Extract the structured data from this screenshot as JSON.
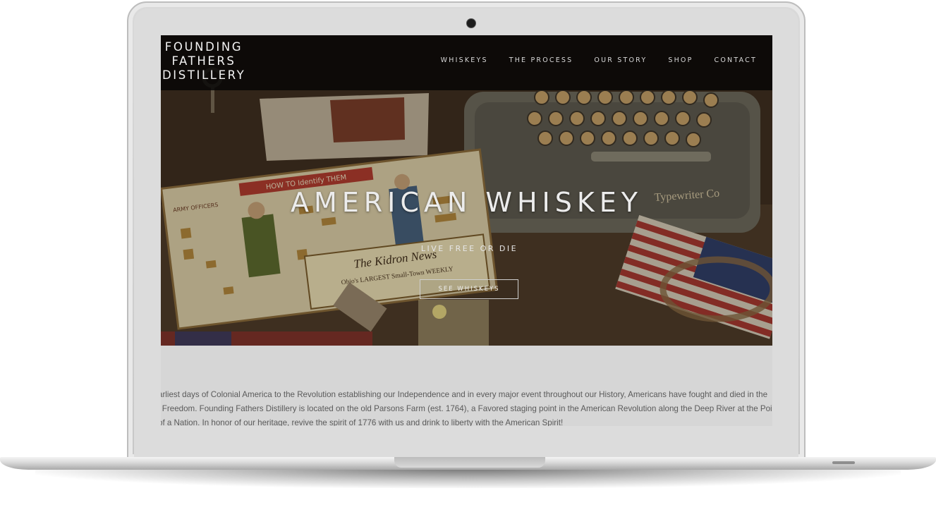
{
  "site": {
    "logo_lines": [
      "FOUNDING",
      "FATHERS",
      "DISTILLERY"
    ],
    "nav": [
      "WHISKEYS",
      "THE PROCESS",
      "OUR STORY",
      "SHOP",
      "CONTACT"
    ]
  },
  "hero": {
    "title": "AMERICAN WHISKEY",
    "subtitle": "LIVE FREE OR DIE",
    "button": "SEE WHISKEYS",
    "sign_headline": "The Kidron News",
    "sign_sub": "Ohio's LARGEST Small-Town WEEKLY",
    "chart_banner": "HOW TO Identify THEM",
    "chart_label_left": "ARMY OFFICERS",
    "typewriter_label": "Typewriter Co"
  },
  "story": {
    "lines": [
      "arliest days of Colonial America to the Revolution establishing our Independence and in every major event throughout our History, Americans have fought and died in the",
      "l Freedom. Founding Fathers Distillery is located on the old Parsons Farm (est. 1764), a Favored staging point in the American Revolution along the Deep River at the Point",
      "of a Nation. In honor of our heritage, revive the spirit of 1776 with us and drink to liberty with the American Spirit!"
    ]
  },
  "colors": {
    "navbar": "#0a0a0a",
    "hero_text": "#ececec",
    "page_bg": "#d6d6d6",
    "body_text": "#5a5a5a"
  }
}
